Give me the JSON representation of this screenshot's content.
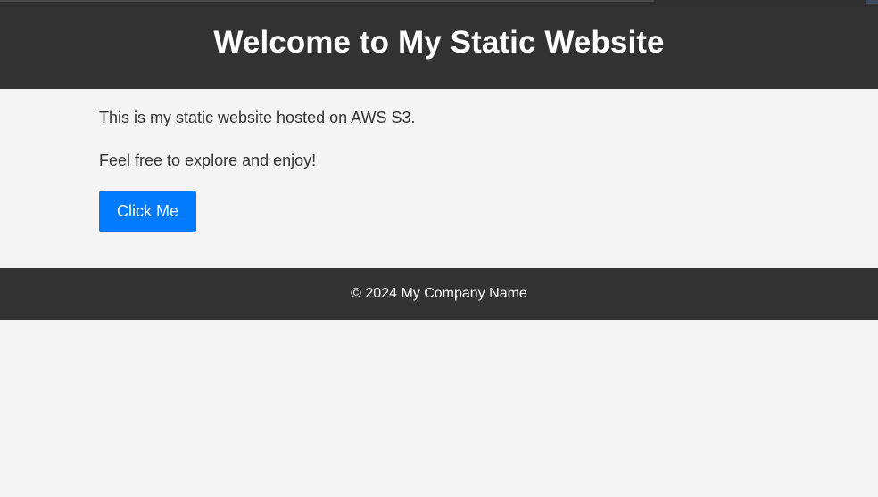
{
  "header": {
    "title": "Welcome to My Static Website"
  },
  "main": {
    "paragraphs": [
      "This is my static website hosted on AWS S3.",
      "Feel free to explore and enjoy!"
    ],
    "button_label": "Click Me"
  },
  "footer": {
    "copyright": "© 2024 My Company Name"
  },
  "colors": {
    "header_bg": "#333333",
    "page_bg": "#f4f4f4",
    "button_bg": "#007bff",
    "text": "#333333"
  }
}
